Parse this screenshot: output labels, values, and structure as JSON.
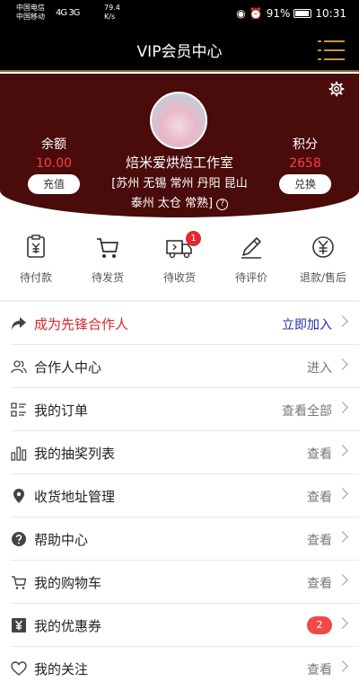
{
  "status_bar": {
    "carrier1": "中国电信",
    "carrier2": "中国移动",
    "signal": "4G 3G",
    "speed": "79.4",
    "speed_unit": "K/s",
    "battery": "91%",
    "time": "10:31"
  },
  "header": {
    "title": "VIP会员中心",
    "accent_color": "#c8933e"
  },
  "profile": {
    "balance_label": "余额",
    "balance_value": "10.00",
    "recharge_label": "充值",
    "points_label": "积分",
    "points_value": "2658",
    "redeem_label": "兑换",
    "shop_name": "焙米爱烘焙工作室",
    "area_line1": "[苏州 无锡 常州 丹阳 昆山",
    "area_line2": "泰州 太仓 常熟]",
    "help_mark": "?",
    "bg_color": "#4a0b0b"
  },
  "orders": [
    {
      "label": "待付款",
      "icon": "payment-icon"
    },
    {
      "label": "待发货",
      "icon": "cart-icon"
    },
    {
      "label": "待收货",
      "icon": "truck-icon",
      "badge": "1"
    },
    {
      "label": "待评价",
      "icon": "pencil-icon"
    },
    {
      "label": "退款/售后",
      "icon": "yuan-icon"
    }
  ],
  "menu": [
    {
      "label": "成为先锋合作人",
      "action": "立即加入",
      "icon": "share-arrow-icon"
    },
    {
      "label": "合作人中心",
      "action": "进入",
      "icon": "users-icon"
    },
    {
      "label": "我的订单",
      "action": "查看全部",
      "icon": "list-icon"
    },
    {
      "label": "我的抽奖列表",
      "action": "查看",
      "icon": "bar-chart-icon"
    },
    {
      "label": "收货地址管理",
      "action": "查看",
      "icon": "location-pin-icon"
    },
    {
      "label": "帮助中心",
      "action": "查看",
      "icon": "help-icon"
    },
    {
      "label": "我的购物车",
      "action": "查看",
      "icon": "cart-icon"
    },
    {
      "label": "我的优惠券",
      "badge": "2",
      "icon": "coupon-icon"
    },
    {
      "label": "我的关注",
      "action": "查看",
      "icon": "heart-icon"
    }
  ]
}
